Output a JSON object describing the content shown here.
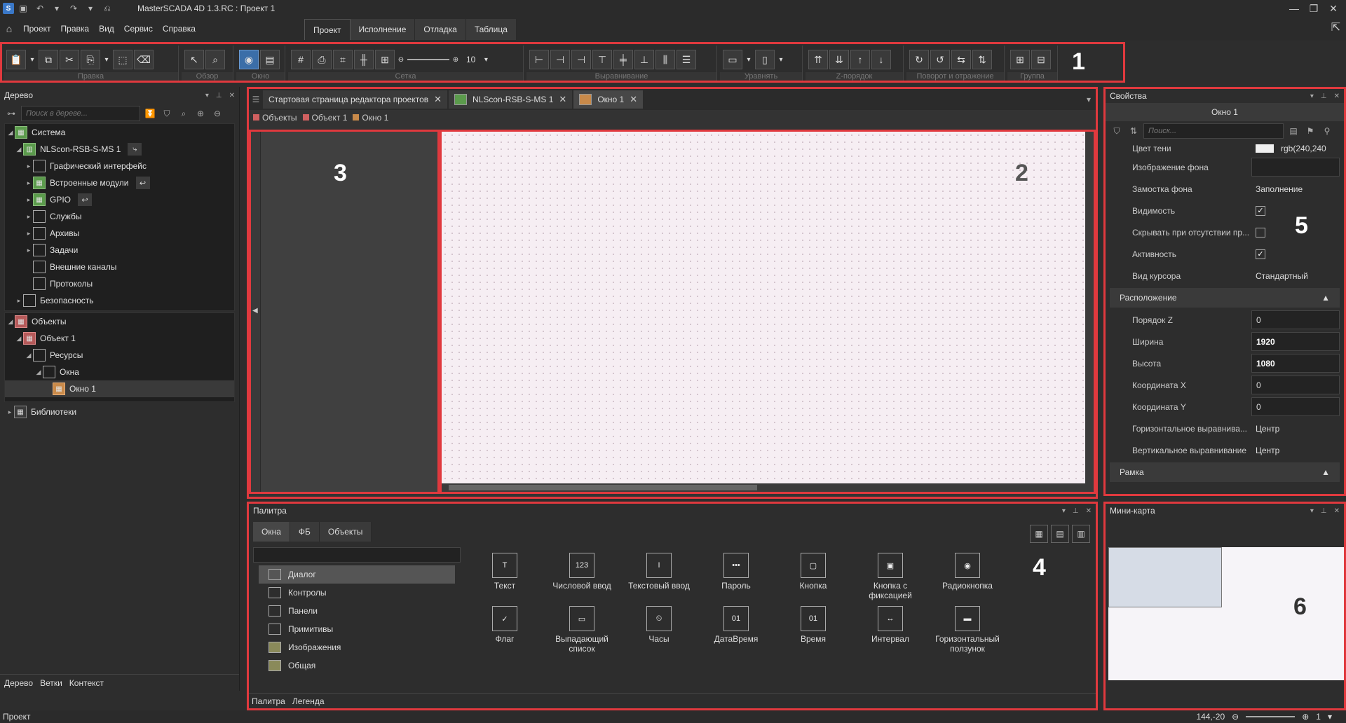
{
  "title": "MasterSCADA 4D 1.3.RC :  Проект 1",
  "menu": [
    "Проект",
    "Правка",
    "Вид",
    "Сервис",
    "Справка"
  ],
  "ribbon_tabs": [
    "Проект",
    "Исполнение",
    "Отладка",
    "Таблица"
  ],
  "toolbar": {
    "groups": [
      "Правка",
      "Обзор",
      "Окно",
      "Сетка",
      "Выравнивание",
      "Уравнять",
      "Z-порядок",
      "Поворот и отражение",
      "Группа"
    ],
    "zoom_value": "10"
  },
  "tree": {
    "title": "Дерево",
    "search_placeholder": "Поиск в дереве...",
    "nodes": [
      "Система",
      "NLScon-RSB-S-MS 1",
      "Графический интерфейс",
      "Встроенные модули",
      "GPIO",
      "Службы",
      "Архивы",
      "Задачи",
      "Внешние каналы",
      "Протоколы",
      "Безопасность",
      "Объекты",
      "Объект 1",
      "Ресурсы",
      "Окна",
      "Окно 1",
      "Библиотеки"
    ],
    "bottom_tabs": [
      "Дерево",
      "Ветки",
      "Контекст"
    ]
  },
  "editor": {
    "tabs": [
      "Стартовая страница редактора проектов",
      "NLScon-RSB-S-MS 1",
      "Окно 1"
    ],
    "crumbs": [
      "Объекты",
      "Объект 1",
      "Окно 1"
    ],
    "crumb_colors": [
      "#d06060",
      "#d06060",
      "#c98a4a"
    ]
  },
  "labels": {
    "n1": "1",
    "n2": "2",
    "n3": "3",
    "n4": "4",
    "n5": "5",
    "n6": "6"
  },
  "palette": {
    "title": "Палитра",
    "tabs": [
      "Окна",
      "ФБ",
      "Объекты"
    ],
    "search_placeholder": "",
    "list": [
      "Диалог",
      "Контролы",
      "Панели",
      "Примитивы",
      "Изображения",
      "Общая"
    ],
    "items": [
      "Текст",
      "Числовой ввод",
      "Текстовый ввод",
      "Пароль",
      "Кнопка",
      "Кнопка с фиксацией",
      "Радиокнопка",
      "Флаг",
      "Выпадающий список",
      "Часы",
      "ДатаВремя",
      "Время",
      "Интервал",
      "Горизонтальный ползунок"
    ],
    "bottom_tabs": [
      "Палитра",
      "Легенда"
    ]
  },
  "props": {
    "title": "Свойства",
    "object": "Окно 1",
    "search_placeholder": "Поиск...",
    "rows": [
      {
        "name": "Цвет тени",
        "value": "rgb(240,240"
      },
      {
        "name": "Изображение фона",
        "value": ""
      },
      {
        "name": "Замостка фона",
        "value": "Заполнение"
      },
      {
        "name": "Видимость",
        "value": "✓"
      },
      {
        "name": "Скрывать при отсутствии пр...",
        "value": ""
      },
      {
        "name": "Активность",
        "value": "✓"
      },
      {
        "name": "Вид курсора",
        "value": "Стандартный"
      }
    ],
    "section_location": "Расположение",
    "location_rows": [
      {
        "name": "Порядок Z",
        "value": "0"
      },
      {
        "name": "Ширина",
        "value": "1920"
      },
      {
        "name": "Высота",
        "value": "1080"
      },
      {
        "name": "Координата X",
        "value": "0"
      },
      {
        "name": "Координата Y",
        "value": "0"
      },
      {
        "name": "Горизонтальное выравнива...",
        "value": "Центр"
      },
      {
        "name": "Вертикальное выравнивание",
        "value": "Центр"
      }
    ],
    "section_frame": "Рамка"
  },
  "minimap": {
    "title": "Мини-карта"
  },
  "status": {
    "text": "Проект",
    "coords": "144,-20",
    "zoom": "1"
  }
}
